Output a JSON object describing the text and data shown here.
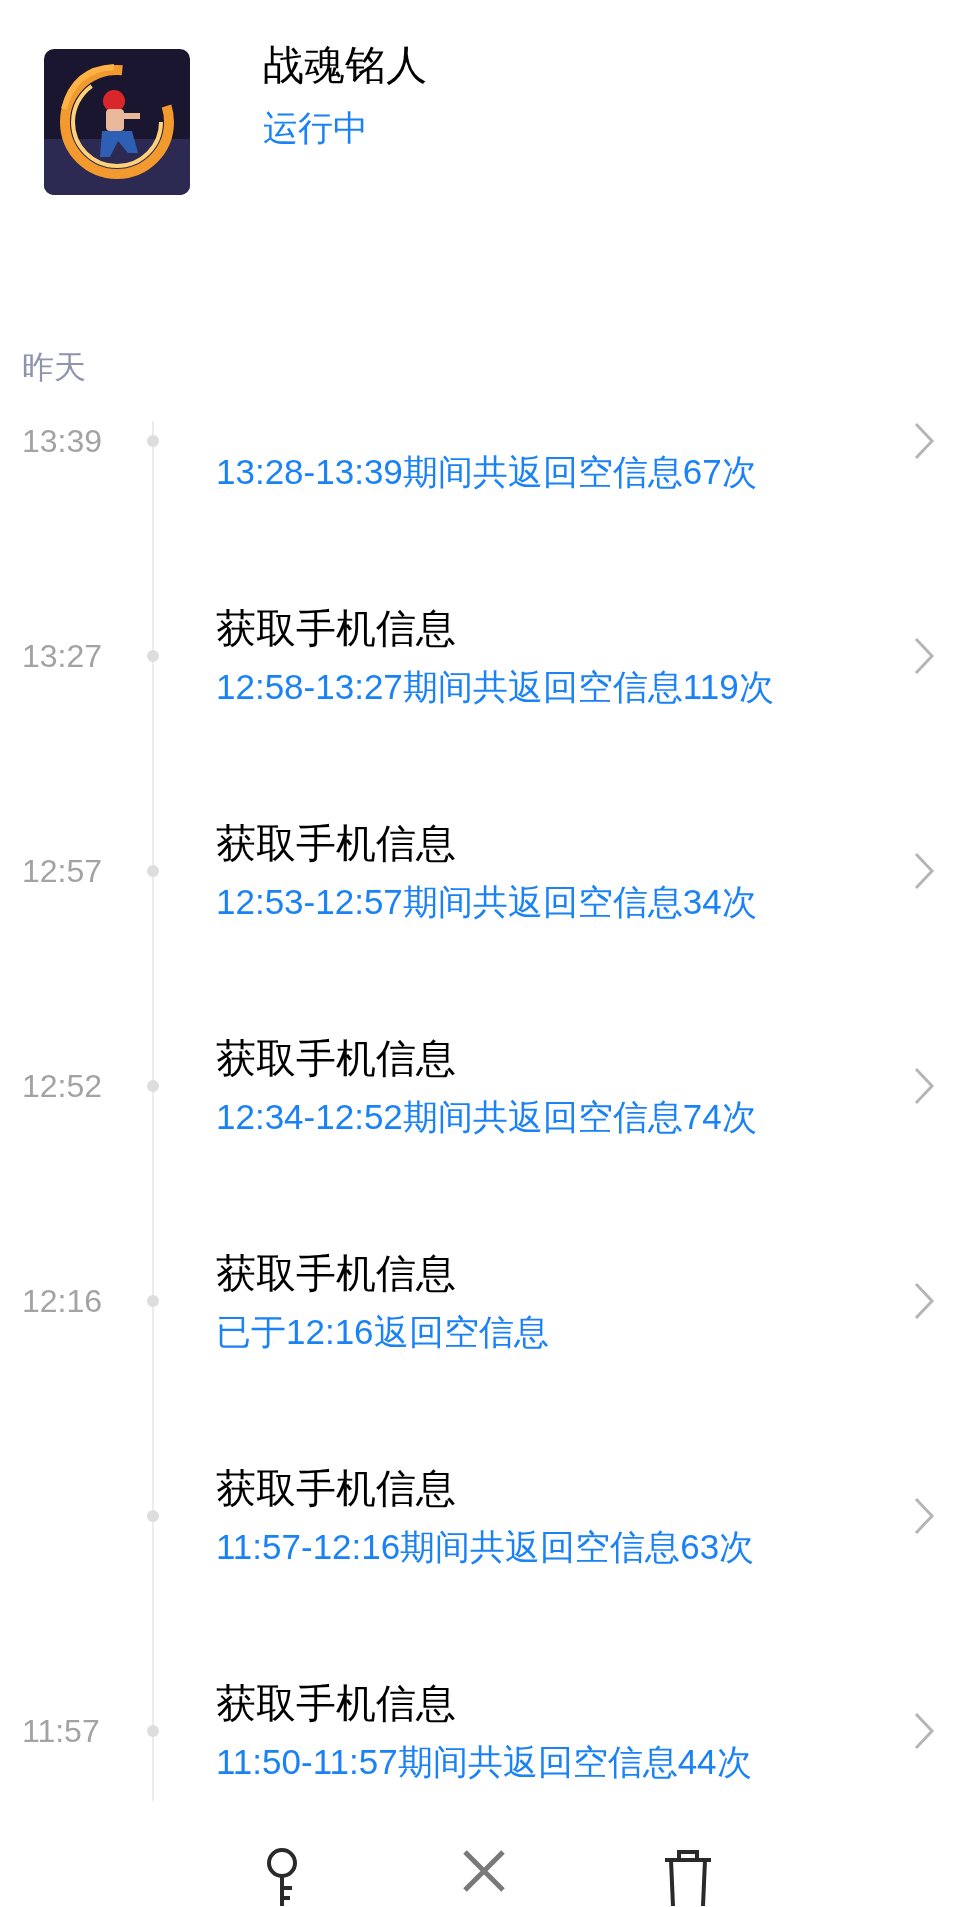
{
  "app": {
    "kind": "picture",
    "name": "战魂铭人",
    "status": "运行中"
  },
  "section": "昨天",
  "records": [
    {
      "time": "13:39",
      "detail": "13:28-13:39期间共返回空信息67次"
    },
    {
      "time": "13:27",
      "title": "获取手机信息",
      "detail": "12:58-13:27期间共返回空信息119次"
    },
    {
      "time": "12:57",
      "title": "获取手机信息",
      "detail": "12:53-12:57期间共返回空信息34次"
    },
    {
      "time": "12:52",
      "title": "获取手机信息",
      "detail": "12:34-12:52期间共返回空信息74次"
    },
    {
      "time": "12:16",
      "title": "获取手机信息",
      "detail": "已于12:16返回空信息"
    },
    {
      "title": "获取手机信息",
      "detail": "11:57-12:16期间共返回空信息63次"
    },
    {
      "time": "11:57",
      "title": "获取手机信息",
      "detail": "11:50-11:57期间共返回空信息44次"
    }
  ],
  "toolbar": [
    {
      "kind": "key"
    },
    {
      "kind": "close"
    },
    {
      "kind": "delete"
    }
  ]
}
